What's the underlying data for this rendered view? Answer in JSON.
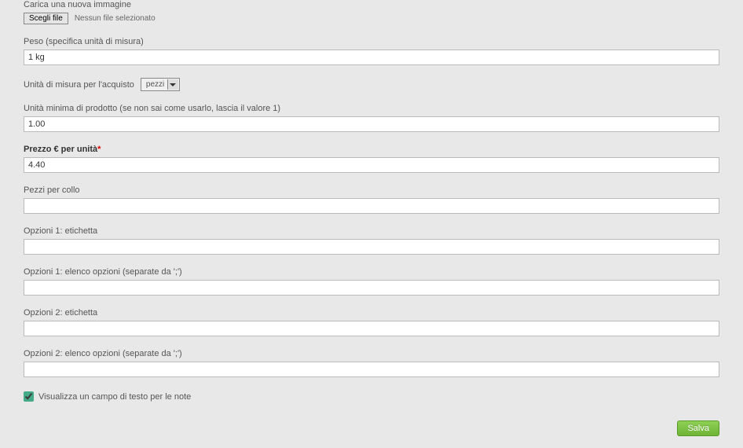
{
  "upload": {
    "label": "Carica una nuova immagine",
    "button": "Scegli file",
    "status": "Nessun file selezionato"
  },
  "peso": {
    "label": "Peso (specifica unità di misura)",
    "value": "1 kg"
  },
  "unita_misura": {
    "label": "Unità di misura per l'acquisto",
    "selected": "pezzi"
  },
  "unita_minima": {
    "label": "Unità minima di prodotto (se non sai come usarlo, lascia il valore 1)",
    "value": "1.00"
  },
  "prezzo": {
    "label": "Prezzo € per unità",
    "value": "4.40"
  },
  "pezzi_collo": {
    "label": "Pezzi per collo",
    "value": ""
  },
  "opzioni1_etichetta": {
    "label": "Opzioni 1: etichetta",
    "value": ""
  },
  "opzioni1_elenco": {
    "label": "Opzioni 1: elenco opzioni (separate da ';')",
    "value": ""
  },
  "opzioni2_etichetta": {
    "label": "Opzioni 2: etichetta",
    "value": ""
  },
  "opzioni2_elenco": {
    "label": "Opzioni 2: elenco opzioni (separate da ';')",
    "value": ""
  },
  "note_checkbox": {
    "label": "Visualizza un campo di testo per le note",
    "checked": true
  },
  "save": {
    "label": "Salva"
  }
}
